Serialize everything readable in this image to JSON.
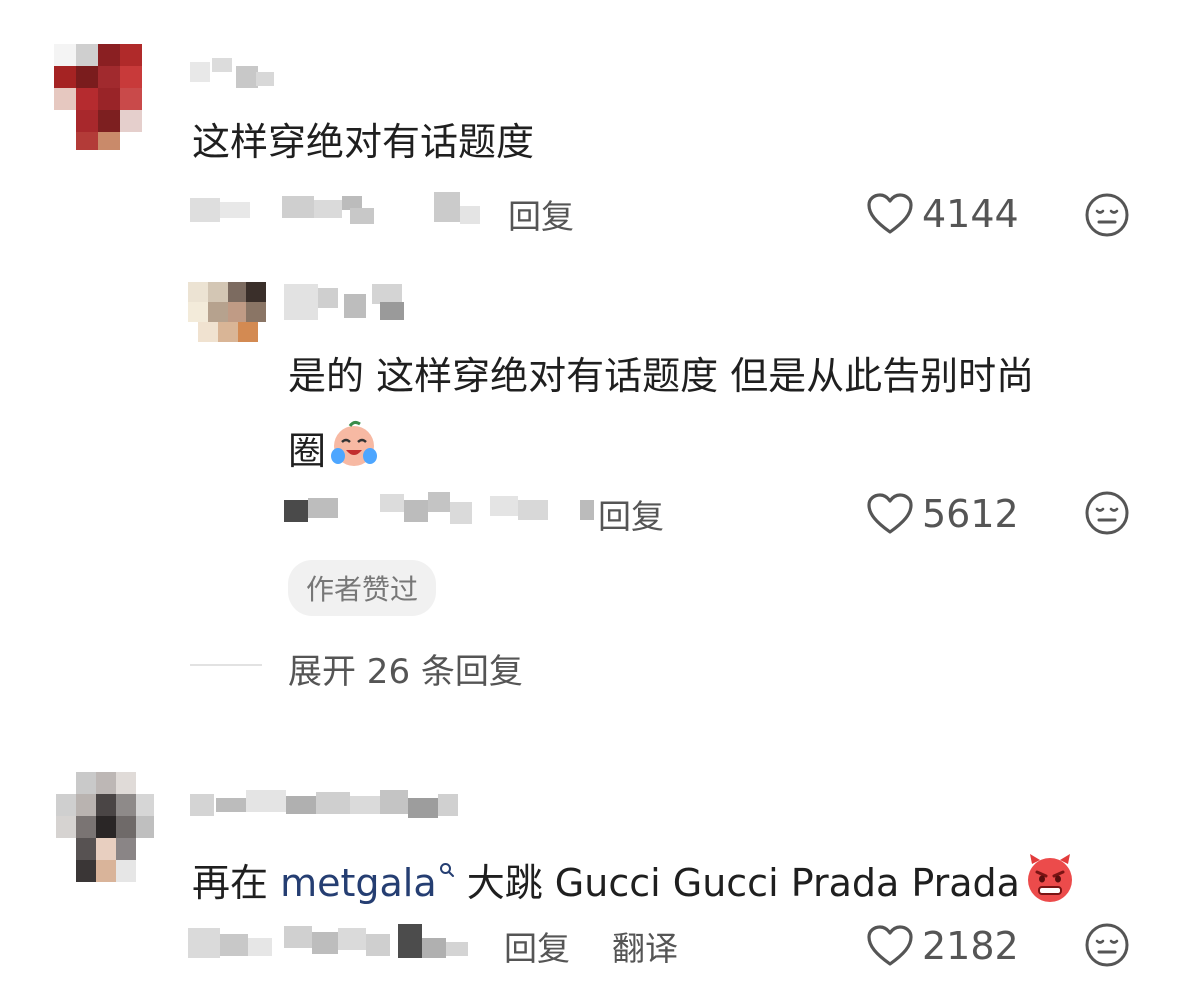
{
  "comments": [
    {
      "text": "这样穿绝对有话题度",
      "reply_label": "回复",
      "likes": "4144",
      "replies": [
        {
          "text_line1": "是的 这样穿绝对有话题度 但是从此告别时尚",
          "text_line2": "圈",
          "reply_label": "回复",
          "likes": "5612",
          "badge": "作者赞过"
        }
      ],
      "expand_label": "展开 26 条回复"
    },
    {
      "text_prefix": "再在 ",
      "hashtag": "metgala",
      "text_suffix": " 大跳 Gucci Gucci Prada Prada",
      "reply_label": "回复",
      "translate_label": "翻译",
      "likes": "2182"
    }
  ],
  "icons": {
    "like": "heart-outline-icon",
    "dislike": "meh-face-icon",
    "emoji_laugh_cry": "laugh-cry-emoji",
    "emoji_angry": "angry-devil-emoji",
    "hashtag_search": "search-small-icon"
  },
  "colors": {
    "hashtag": "#253e72",
    "secondary_text": "#555555",
    "badge_bg": "#f1f1f1"
  }
}
